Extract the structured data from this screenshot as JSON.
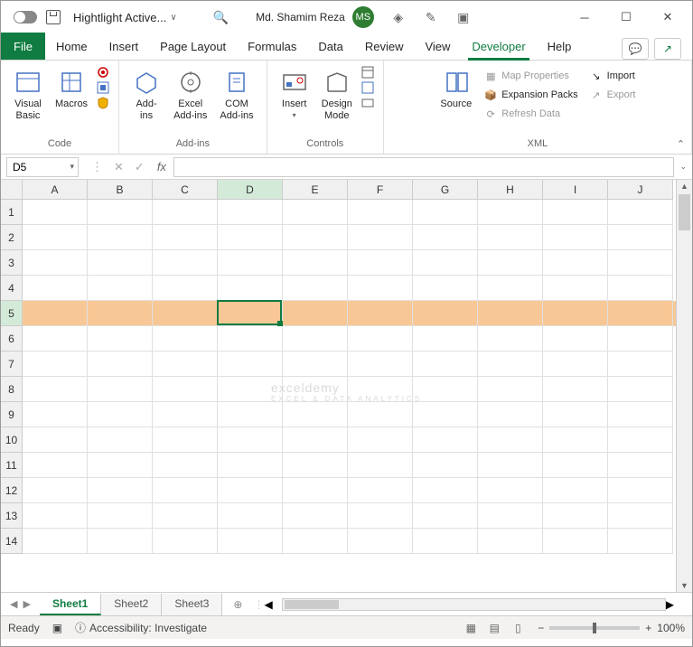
{
  "titlebar": {
    "doc_name": "Hightlight Active...",
    "user_name": "Md. Shamim Reza",
    "avatar_initials": "MS"
  },
  "tabs": {
    "file": "File",
    "items": [
      "Home",
      "Insert",
      "Page Layout",
      "Formulas",
      "Data",
      "Review",
      "View",
      "Developer",
      "Help"
    ],
    "active_index": 7
  },
  "ribbon": {
    "groups": [
      {
        "label": "Code",
        "buttons": [
          {
            "label": "Visual\nBasic"
          },
          {
            "label": "Macros"
          }
        ]
      },
      {
        "label": "Add-ins",
        "buttons": [
          {
            "label": "Add-\nins"
          },
          {
            "label": "Excel\nAdd-ins"
          },
          {
            "label": "COM\nAdd-ins"
          }
        ]
      },
      {
        "label": "Controls",
        "buttons": [
          {
            "label": "Insert",
            "drop": true
          },
          {
            "label": "Design\nMode"
          }
        ]
      },
      {
        "label": "XML",
        "buttons": [
          {
            "label": "Source"
          }
        ],
        "small_items": [
          {
            "label": "Map Properties",
            "disabled": true
          },
          {
            "label": "Expansion Packs",
            "disabled": false
          },
          {
            "label": "Refresh Data",
            "disabled": true
          }
        ],
        "small_items2": [
          {
            "label": "Import",
            "disabled": false
          },
          {
            "label": "Export",
            "disabled": true
          }
        ]
      }
    ]
  },
  "formula": {
    "name_box": "D5",
    "value": ""
  },
  "grid": {
    "columns": [
      "A",
      "B",
      "C",
      "D",
      "E",
      "F",
      "G",
      "H",
      "I",
      "J"
    ],
    "rows": [
      1,
      2,
      3,
      4,
      5,
      6,
      7,
      8,
      9,
      10,
      11,
      12,
      13,
      14
    ],
    "active_col": 3,
    "active_row": 4,
    "highlight_row": 4
  },
  "sheets": {
    "items": [
      "Sheet1",
      "Sheet2",
      "Sheet3"
    ],
    "active_index": 0
  },
  "status": {
    "mode": "Ready",
    "accessibility": "Accessibility: Investigate",
    "zoom": "100%"
  },
  "watermark": {
    "main": "exceldemy",
    "sub": "EXCEL & DATA ANALYTICS"
  }
}
